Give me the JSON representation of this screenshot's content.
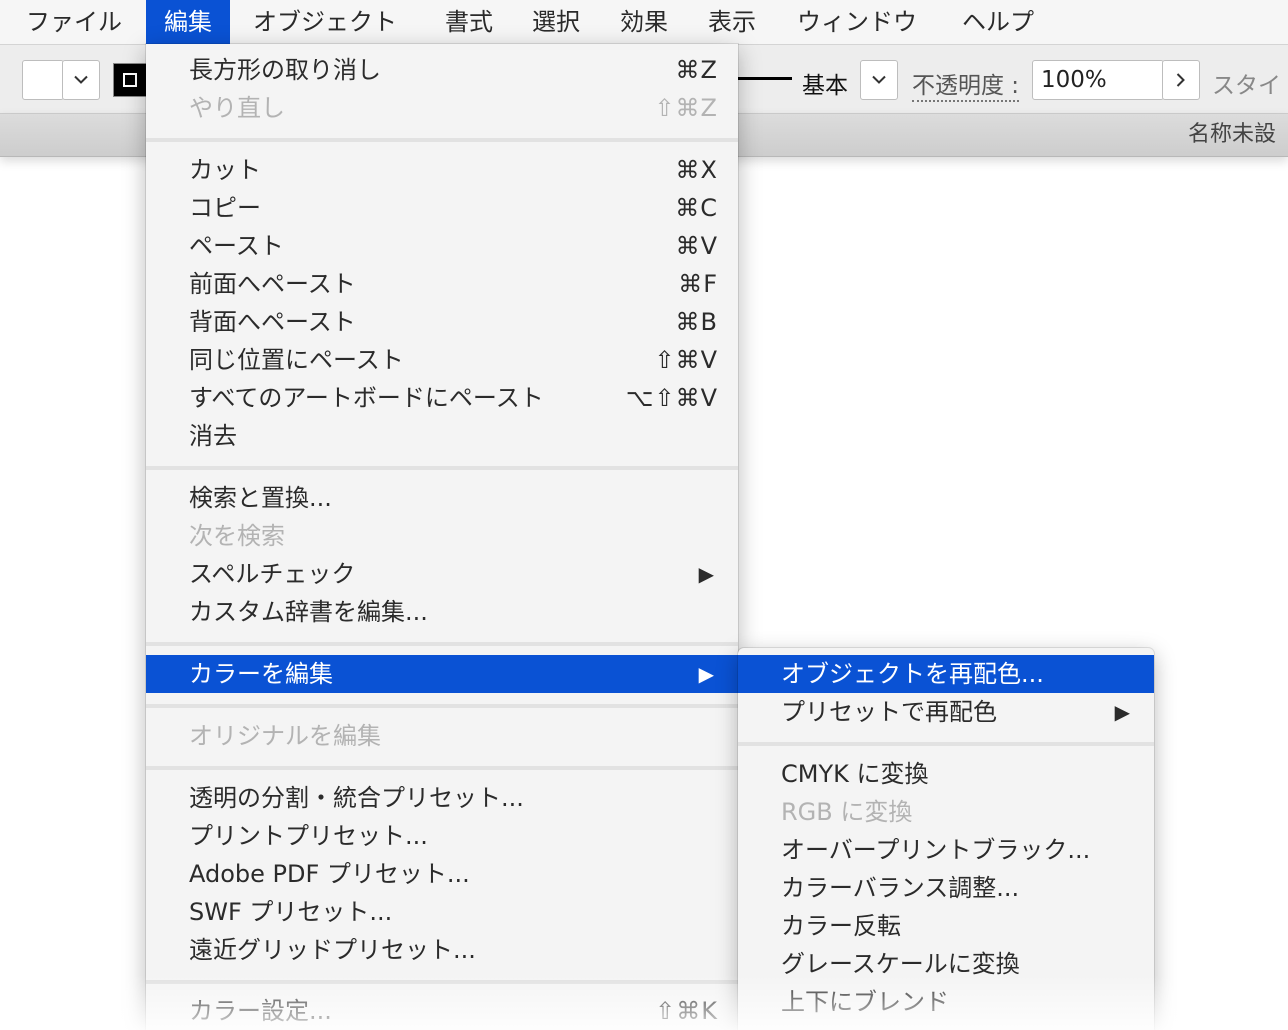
{
  "menubar": {
    "items": [
      "ファイル",
      "編集",
      "オブジェクト",
      "書式",
      "選択",
      "効果",
      "表示",
      "ウィンドウ",
      "ヘルプ"
    ]
  },
  "controlbar": {
    "stroke_profile": "基本",
    "opacity_label": "不透明度 :",
    "opacity_value": "100%",
    "style_label": "スタイ"
  },
  "tabbar": {
    "doc_title": "名称未設"
  },
  "edit_menu": {
    "items": [
      {
        "label": "長方形の取り消し",
        "shortcut": "⌘Z",
        "enabled": true
      },
      {
        "label": "やり直し",
        "shortcut": "⇧⌘Z",
        "enabled": false
      },
      {
        "label": "カット",
        "shortcut": "⌘X",
        "enabled": true
      },
      {
        "label": "コピー",
        "shortcut": "⌘C",
        "enabled": true
      },
      {
        "label": "ペースト",
        "shortcut": "⌘V",
        "enabled": true
      },
      {
        "label": "前面へペースト",
        "shortcut": "⌘F",
        "enabled": true
      },
      {
        "label": "背面へペースト",
        "shortcut": "⌘B",
        "enabled": true
      },
      {
        "label": "同じ位置にペースト",
        "shortcut": "⇧⌘V",
        "enabled": true
      },
      {
        "label": "すべてのアートボードにペースト",
        "shortcut": "⌥⇧⌘V",
        "enabled": true
      },
      {
        "label": "消去",
        "shortcut": "",
        "enabled": true
      },
      {
        "label": "検索と置換...",
        "shortcut": "",
        "enabled": true
      },
      {
        "label": "次を検索",
        "shortcut": "",
        "enabled": false
      },
      {
        "label": "スペルチェック",
        "shortcut": "▶",
        "enabled": true
      },
      {
        "label": "カスタム辞書を編集...",
        "shortcut": "",
        "enabled": true
      },
      {
        "label": "カラーを編集",
        "shortcut": "▶",
        "enabled": true
      },
      {
        "label": "オリジナルを編集",
        "shortcut": "",
        "enabled": false
      },
      {
        "label": "透明の分割・統合プリセット...",
        "shortcut": "",
        "enabled": true
      },
      {
        "label": "プリントプリセット...",
        "shortcut": "",
        "enabled": true
      },
      {
        "label": "Adobe PDF プリセット...",
        "shortcut": "",
        "enabled": true
      },
      {
        "label": "SWF プリセット...",
        "shortcut": "",
        "enabled": true
      },
      {
        "label": "遠近グリッドプリセット...",
        "shortcut": "",
        "enabled": true
      },
      {
        "label": "カラー設定...",
        "shortcut": "⇧⌘K",
        "enabled": true
      }
    ]
  },
  "color_submenu": {
    "items": [
      {
        "label": "オブジェクトを再配色...",
        "shortcut": "",
        "enabled": true
      },
      {
        "label": "プリセットで再配色",
        "shortcut": "▶",
        "enabled": true
      },
      {
        "label": "CMYK に変換",
        "shortcut": "",
        "enabled": true
      },
      {
        "label": "RGB に変換",
        "shortcut": "",
        "enabled": false
      },
      {
        "label": "オーバープリントブラック...",
        "shortcut": "",
        "enabled": true
      },
      {
        "label": "カラーバランス調整...",
        "shortcut": "",
        "enabled": true
      },
      {
        "label": "カラー反転",
        "shortcut": "",
        "enabled": true
      },
      {
        "label": "グレースケールに変換",
        "shortcut": "",
        "enabled": true
      },
      {
        "label": "上下にブレンド",
        "shortcut": "",
        "enabled": true
      }
    ]
  },
  "colors": {
    "highlight": "#0a52d4",
    "disabled_text": "#b3b3b3"
  }
}
